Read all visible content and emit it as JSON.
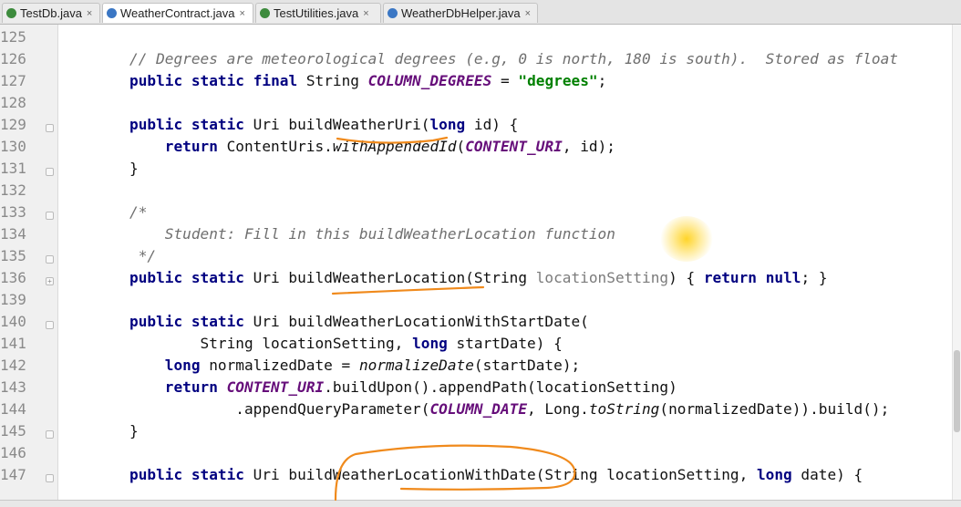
{
  "tabs": [
    {
      "label": "TestDb.java",
      "icon": "test-class-icon",
      "active": false
    },
    {
      "label": "WeatherContract.java",
      "icon": "class-icon",
      "active": true
    },
    {
      "label": "TestUtilities.java",
      "icon": "test-class-icon",
      "active": false
    },
    {
      "label": "WeatherDbHelper.java",
      "icon": "class-icon",
      "active": false
    }
  ],
  "close_glyph": "×",
  "gutter_marker": "+",
  "lines": [
    {
      "num": "125",
      "code": ""
    },
    {
      "num": "126",
      "code": "// Degrees are meteorological degrees (e.g, 0 is north, 180 is south).  Stored as float"
    },
    {
      "num": "127",
      "code": "public static final String COLUMN_DEGREES = \"degrees\";"
    },
    {
      "num": "128",
      "code": ""
    },
    {
      "num": "129",
      "code": "public static Uri buildWeatherUri(long id) {"
    },
    {
      "num": "130",
      "code": "    return ContentUris.withAppendedId(CONTENT_URI, id);"
    },
    {
      "num": "131",
      "code": "}"
    },
    {
      "num": "132",
      "code": ""
    },
    {
      "num": "133",
      "code": "/*"
    },
    {
      "num": "134",
      "code": "    Student: Fill in this buildWeatherLocation function"
    },
    {
      "num": "135",
      "code": " */"
    },
    {
      "num": "136",
      "code": "public static Uri buildWeatherLocation(String locationSetting) { return null; }"
    },
    {
      "num": "139",
      "code": ""
    },
    {
      "num": "140",
      "code": "public static Uri buildWeatherLocationWithStartDate("
    },
    {
      "num": "141",
      "code": "        String locationSetting, long startDate) {"
    },
    {
      "num": "142",
      "code": "    long normalizedDate = normalizeDate(startDate);"
    },
    {
      "num": "143",
      "code": "    return CONTENT_URI.buildUpon().appendPath(locationSetting)"
    },
    {
      "num": "144",
      "code": "            .appendQueryParameter(COLUMN_DATE, Long.toString(normalizedDate)).build();"
    },
    {
      "num": "145",
      "code": "}"
    },
    {
      "num": "146",
      "code": ""
    },
    {
      "num": "147",
      "code": "public static Uri buildWeatherLocationWithDate(String locationSetting, long date) {"
    }
  ],
  "colors": {
    "keyword": "#000080",
    "string": "#008000",
    "constant": "#660e7a",
    "comment": "#6f6f6f",
    "annotation": "#f08a1c"
  }
}
